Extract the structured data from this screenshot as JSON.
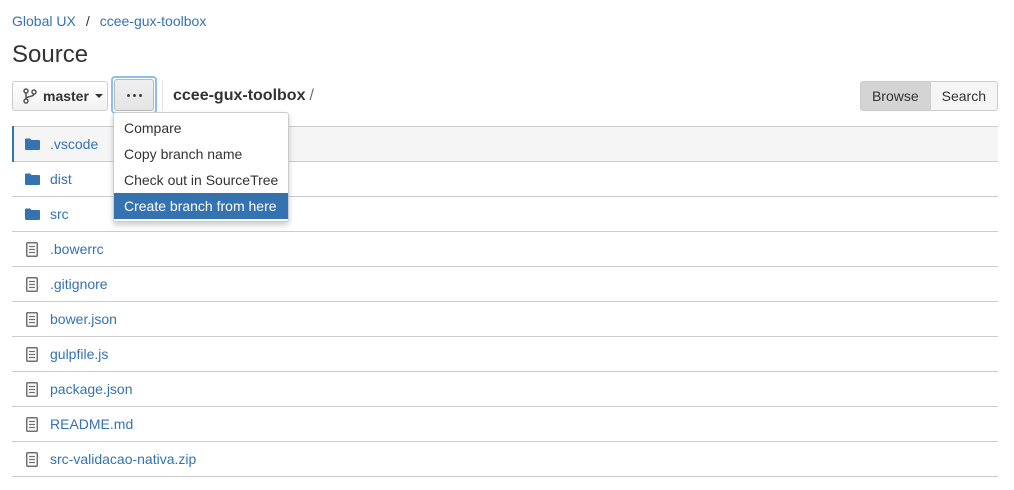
{
  "breadcrumb": {
    "items": [
      "Global UX",
      "ccee-gux-toolbox"
    ],
    "separator": "/"
  },
  "page_title": "Source",
  "toolbar": {
    "branch_label": "master",
    "repo_name": "ccee-gux-toolbox",
    "path_separator": "/",
    "browse_label": "Browse",
    "search_label": "Search"
  },
  "menu": {
    "items": [
      "Compare",
      "Copy branch name",
      "Check out in SourceTree",
      "Create branch from here"
    ],
    "highlighted_index": 3
  },
  "files": [
    {
      "name": ".vscode",
      "type": "folder"
    },
    {
      "name": "dist",
      "type": "folder"
    },
    {
      "name": "src",
      "type": "folder"
    },
    {
      "name": ".bowerrc",
      "type": "file"
    },
    {
      "name": ".gitignore",
      "type": "file"
    },
    {
      "name": "bower.json",
      "type": "file"
    },
    {
      "name": "gulpfile.js",
      "type": "file"
    },
    {
      "name": "package.json",
      "type": "file"
    },
    {
      "name": "README.md",
      "type": "file"
    },
    {
      "name": "src-validacao-nativa.zip",
      "type": "file"
    }
  ],
  "icons": {
    "branch": "branch-icon",
    "more": "more-icon",
    "folder": "folder-icon",
    "file": "file-icon"
  },
  "colors": {
    "link": "#3572b0",
    "highlight": "#3572b0",
    "focus_ring": "#8cbef0"
  }
}
